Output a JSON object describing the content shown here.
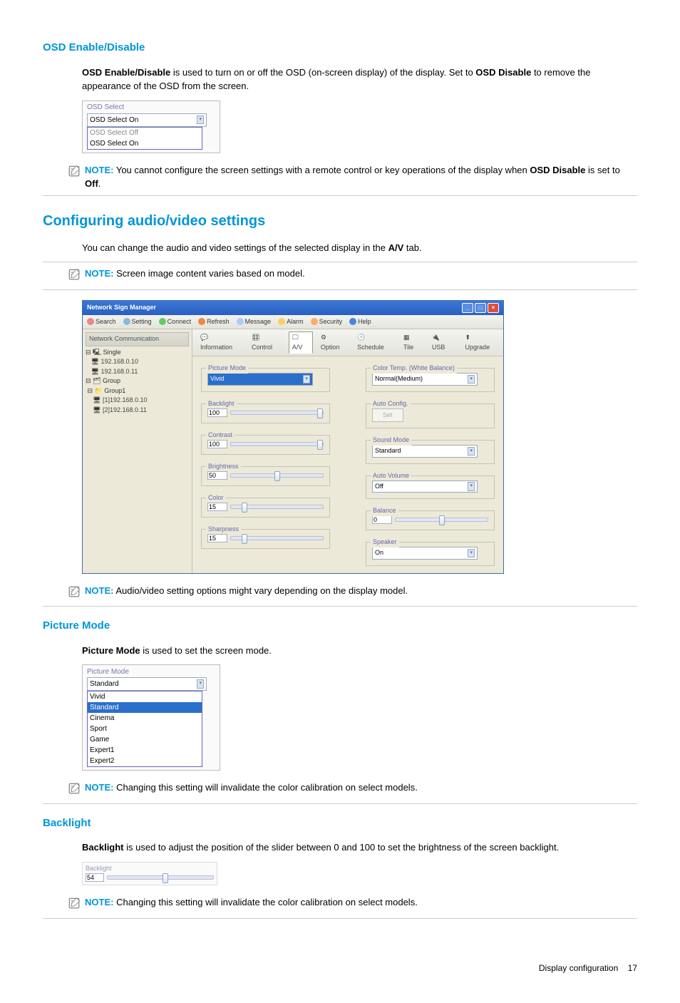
{
  "sections": {
    "osd_enable": {
      "heading": "OSD Enable/Disable",
      "intro_bold": "OSD Enable/Disable",
      "intro_mid": " is used to turn on or off the OSD (on-screen display) of the display. Set to ",
      "intro_bold2": "OSD Disable",
      "intro_end": " to remove the appearance of the OSD from the screen.",
      "select_title": "OSD Select",
      "dropdown_value": "OSD Select On",
      "options": [
        "OSD Select Off",
        "OSD Select On"
      ],
      "note_pre": "You cannot configure the screen settings with a remote control or key operations of the display when ",
      "note_bold": "OSD Disable",
      "note_mid": " is set to ",
      "note_bold2": "Off",
      "note_end": "."
    },
    "config_av": {
      "heading": "Configuring audio/video settings",
      "intro_pre": "You can change the audio and video settings of the selected display in the ",
      "intro_bold": "A/V",
      "intro_end": " tab.",
      "note1": "Screen image content varies based on model.",
      "note2": "Audio/video setting options might vary depending on the display model."
    },
    "picture_mode": {
      "heading": "Picture Mode",
      "intro_bold": "Picture Mode",
      "intro_end": " is used to set the screen mode.",
      "title": "Picture Mode",
      "dropdown": "Standard",
      "options": [
        "Vivid",
        "Standard",
        "Cinema",
        "Sport",
        "Game",
        "Expert1",
        "Expert2"
      ],
      "note": "Changing this setting will invalidate the color calibration on select models."
    },
    "backlight": {
      "heading": "Backlight",
      "intro_bold": "Backlight",
      "intro_end": " is used to adjust the position of the slider between 0 and 100 to set the brightness of the screen backlight.",
      "label": "Backlight",
      "value": "54",
      "note": "Changing this setting will invalidate the color calibration on select models."
    }
  },
  "app": {
    "title": "Network Sign Manager",
    "toolbar": [
      "Search",
      "Setting",
      "Connect",
      "Refresh",
      "Message",
      "Alarm",
      "Security",
      "Help"
    ],
    "left_header": "Network Communication",
    "tree": {
      "single": "Single",
      "ip1": "192.168.0.10",
      "ip2": "192.168.0.11",
      "group": "Group",
      "group1": "Group1",
      "g1": "[1]192.168.0.10",
      "g2": "[2]192.168.0.11"
    },
    "tabs": [
      "Information",
      "Control",
      "A/V",
      "Option",
      "Schedule",
      "Tile",
      "USB",
      "Upgrade"
    ],
    "fields": {
      "picture_mode": {
        "label": "Picture Mode",
        "value": "Vivid"
      },
      "backlight": {
        "label": "Backlight",
        "value": "100"
      },
      "contrast": {
        "label": "Contrast",
        "value": "100"
      },
      "brightness": {
        "label": "Brightness",
        "value": "50"
      },
      "color": {
        "label": "Color",
        "value": "15"
      },
      "sharpness": {
        "label": "Sharpness",
        "value": "15"
      },
      "color_temp": {
        "label": "Color Temp. (White Balance)",
        "value": "Normal(Medium)"
      },
      "auto_config": {
        "label": "Auto Config.",
        "button": "Set"
      },
      "sound_mode": {
        "label": "Sound Mode",
        "value": "Standard"
      },
      "auto_volume": {
        "label": "Auto Volume",
        "value": "Off"
      },
      "balance": {
        "label": "Balance",
        "value": "0"
      },
      "speaker": {
        "label": "Speaker",
        "value": "On"
      }
    }
  },
  "note_label": "NOTE:",
  "footer": {
    "text": "Display configuration",
    "page": "17"
  }
}
